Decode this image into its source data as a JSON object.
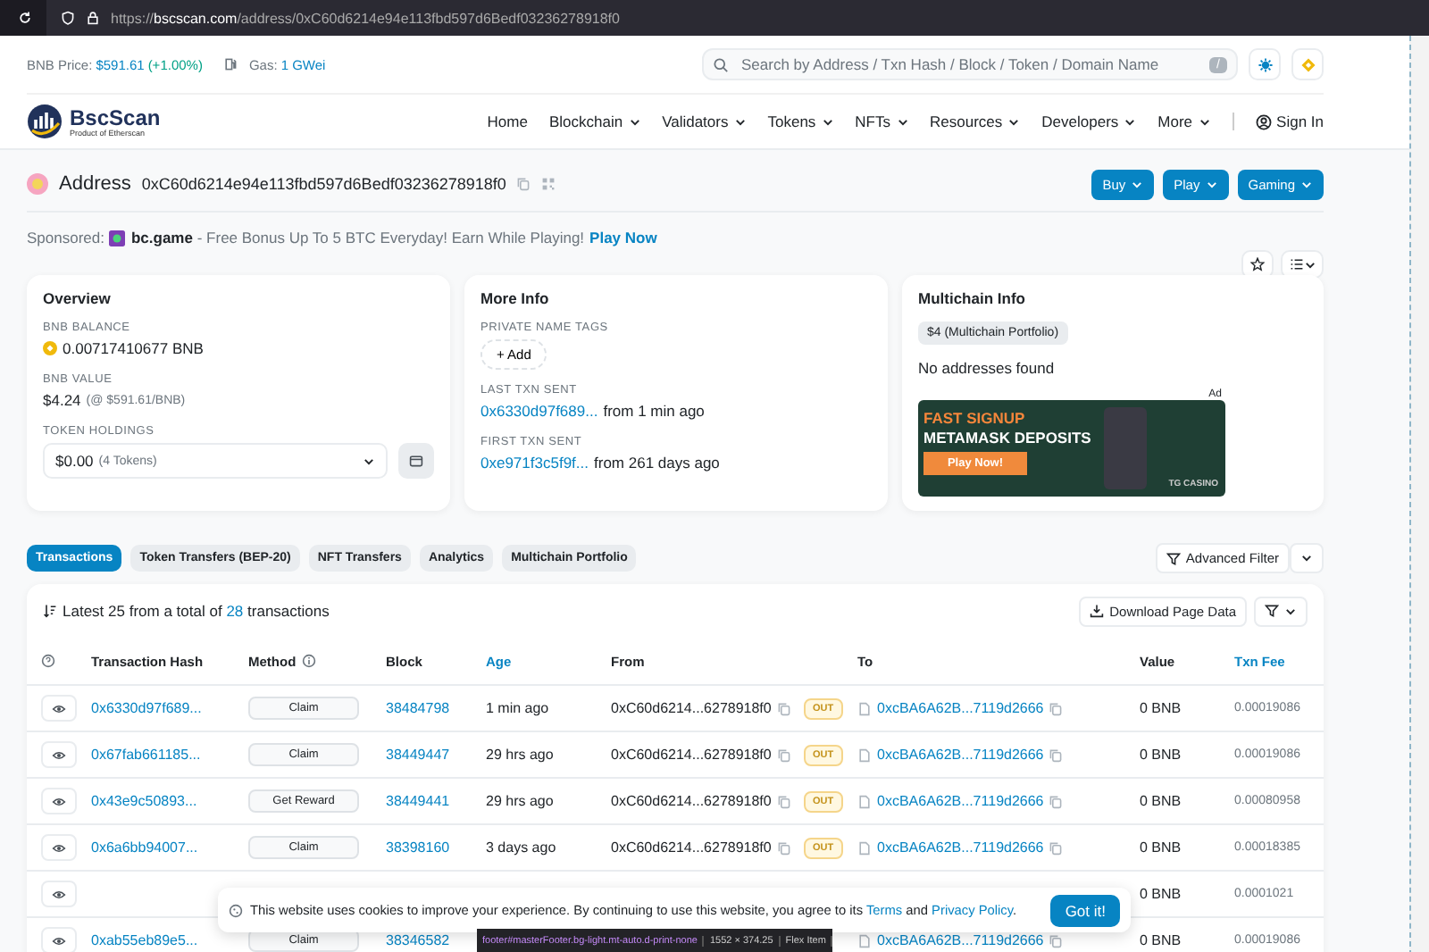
{
  "browser": {
    "url_prefix": "https://",
    "url_host": "bscscan.com",
    "url_path": "/address/0xC60d6214e94e113fbd597d6Bedf03236278918f0"
  },
  "topbar": {
    "price_label": "BNB Price:",
    "price": "$591.61",
    "change": "(+1.00%)",
    "gas_label": "Gas:",
    "gas": "1 GWei",
    "search": {
      "placeholder": "Search by Address / Txn Hash / Block / Token / Domain Name"
    },
    "search_key": "/"
  },
  "logo": {
    "name": "BscScan",
    "tagline": "Product of Etherscan"
  },
  "nav": [
    {
      "label": "Home",
      "dropdown": false
    },
    {
      "label": "Blockchain",
      "dropdown": true
    },
    {
      "label": "Validators",
      "dropdown": true
    },
    {
      "label": "Tokens",
      "dropdown": true
    },
    {
      "label": "NFTs",
      "dropdown": true
    },
    {
      "label": "Resources",
      "dropdown": true
    },
    {
      "label": "Developers",
      "dropdown": true
    },
    {
      "label": "More",
      "dropdown": true
    }
  ],
  "sign_in": "Sign In",
  "address": {
    "title": "Address",
    "value": "0xC60d6214e94e113fbd597d6Bedf03236278918f0"
  },
  "header_buttons": [
    "Buy",
    "Play",
    "Gaming"
  ],
  "sponsored": {
    "label": "Sponsored:",
    "brand": "bc.game",
    "text": "- Free Bonus Up To 5 BTC Everyday! Earn While Playing!",
    "link": "Play Now"
  },
  "overview": {
    "title": "Overview",
    "balance_label": "BNB BALANCE",
    "balance": "0.00717410677 BNB",
    "value_label": "BNB VALUE",
    "value": "$4.24",
    "value_note": "(@ $591.61/BNB)",
    "holdings_label": "TOKEN HOLDINGS",
    "holdings": "$0.00",
    "holdings_note": "(4 Tokens)"
  },
  "more_info": {
    "title": "More Info",
    "tags_label": "PRIVATE NAME TAGS",
    "add_button": "+ Add",
    "last_label": "LAST TXN SENT",
    "last_hash": "0x6330d97f689...",
    "last_time": "from 1 min ago",
    "first_label": "FIRST TXN SENT",
    "first_hash": "0xe971f3c5f9f...",
    "first_time": "from 261 days ago"
  },
  "multichain": {
    "title": "Multichain Info",
    "portfolio": "$4 (Multichain Portfolio)",
    "empty": "No addresses found",
    "ad": {
      "badge": "Ad",
      "line1": "FAST SIGNUP",
      "line2": "METAMASK DEPOSITS",
      "button": "Play Now!",
      "brand": "TG CASINO"
    }
  },
  "tabs": [
    {
      "label": "Transactions",
      "selected": true
    },
    {
      "label": "Token Transfers (BEP-20)",
      "selected": false
    },
    {
      "label": "NFT Transfers",
      "selected": false
    },
    {
      "label": "Analytics",
      "selected": false
    },
    {
      "label": "Multichain Portfolio",
      "selected": false
    }
  ],
  "advanced_filter": "Advanced Filter",
  "table": {
    "summary_prefix": "Latest 25 from a total of",
    "summary_count": "28",
    "summary_suffix": "transactions",
    "download": "Download Page Data",
    "columns": [
      {
        "label": "Transaction Hash",
        "link": false,
        "info": false
      },
      {
        "label": "Method",
        "link": false,
        "info": true
      },
      {
        "label": "Block",
        "link": false,
        "info": false
      },
      {
        "label": "Age",
        "link": true,
        "info": false
      },
      {
        "label": "From",
        "link": false,
        "info": false
      },
      {
        "label": "To",
        "link": false,
        "info": false
      },
      {
        "label": "Value",
        "link": false,
        "info": false
      },
      {
        "label": "Txn Fee",
        "link": true,
        "info": false
      }
    ],
    "rows": [
      {
        "hash": "0x6330d97f689...",
        "method": "Claim",
        "block": "38484798",
        "age": "1 min ago",
        "from": "0xC60d6214...6278918f0",
        "direction": "OUT",
        "to": "0xcBA6A62B...7119d2666",
        "value": "0 BNB",
        "fee": "0.00019086"
      },
      {
        "hash": "0x67fab661185...",
        "method": "Claim",
        "block": "38449447",
        "age": "29 hrs ago",
        "from": "0xC60d6214...6278918f0",
        "direction": "OUT",
        "to": "0xcBA6A62B...7119d2666",
        "value": "0 BNB",
        "fee": "0.00019086"
      },
      {
        "hash": "0x43e9c50893...",
        "method": "Get Reward",
        "block": "38449441",
        "age": "29 hrs ago",
        "from": "0xC60d6214...6278918f0",
        "direction": "OUT",
        "to": "0xcBA6A62B...7119d2666",
        "value": "0 BNB",
        "fee": "0.00080958"
      },
      {
        "hash": "0x6a6bb94007...",
        "method": "Claim",
        "block": "38398160",
        "age": "3 days ago",
        "from": "0xC60d6214...6278918f0",
        "direction": "OUT",
        "to": "0xcBA6A62B...7119d2666",
        "value": "0 BNB",
        "fee": "0.00018385"
      },
      {
        "value": "0 BNB",
        "fee": "0.0001021"
      },
      {
        "hash": "0xab55eb89e5...",
        "method": "Claim",
        "block": "38346582",
        "to": "0xcBA6A62B...7119d2666",
        "value": "0 BNB",
        "fee": "0.00019086"
      }
    ]
  },
  "cookie": {
    "text": "This website uses cookies to improve your experience. By continuing to use this website, you agree to its",
    "terms": "Terms",
    "and": "and",
    "privacy": "Privacy Policy",
    "end": ".",
    "button": "Got it!"
  },
  "devtools_tooltip": {
    "selector": "footer#masterFooter.bg-light.mt-auto.d-print-none",
    "size": "1552 × 374.25",
    "kind": "Flex Item"
  }
}
